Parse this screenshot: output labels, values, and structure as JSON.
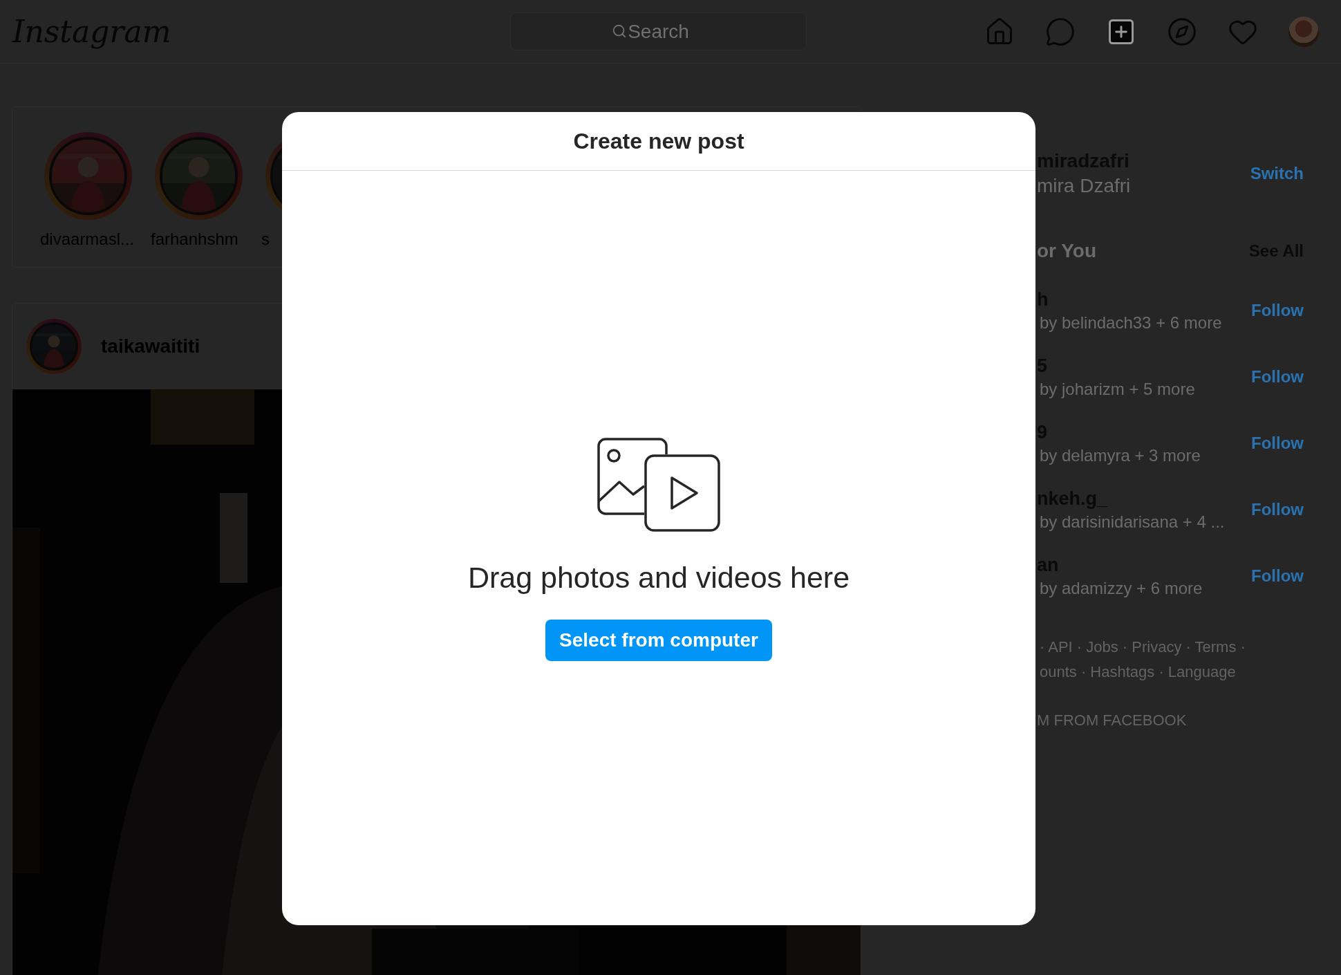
{
  "nav": {
    "logo": "Instagram",
    "search": {
      "placeholder": "Search"
    },
    "icons": [
      {
        "kind": "home",
        "selected": false
      },
      {
        "kind": "messenger",
        "selected": false
      },
      {
        "kind": "new-post",
        "selected": true
      },
      {
        "kind": "explore",
        "selected": false
      },
      {
        "kind": "activity",
        "selected": false
      },
      {
        "kind": "profile",
        "selected": false
      }
    ]
  },
  "stories": [
    {
      "username": "divaarmasl..."
    },
    {
      "username": "farhanhshm"
    },
    {
      "username": "s"
    }
  ],
  "post": {
    "username": "taikawaititi"
  },
  "sidebar": {
    "username": "miradzafri",
    "full_name": "mira Dzafri",
    "switch": "Switch",
    "suggestions_title": "or You",
    "see_all": "See All",
    "suggestions": [
      {
        "name": "h",
        "followed_by": "by belindach33 + 6 more",
        "action": "Follow"
      },
      {
        "name": "5",
        "followed_by": "by joharizm + 5 more",
        "action": "Follow"
      },
      {
        "name": "9",
        "followed_by": "by delamyra + 3 more",
        "action": "Follow"
      },
      {
        "name": "nkeh.g_",
        "followed_by": "by darisinidarisana + 4 ...",
        "action": "Follow"
      },
      {
        "name": "an",
        "followed_by": "by adamizzy + 6 more",
        "action": "Follow"
      }
    ],
    "footer_links": [
      "· API · Jobs · Privacy · Terms ·",
      "ounts · Hashtags · Language"
    ],
    "copyright": "M FROM FACEBOOK"
  },
  "modal": {
    "title": "Create new post",
    "prompt": "Drag photos and videos here",
    "button": "Select from computer"
  }
}
